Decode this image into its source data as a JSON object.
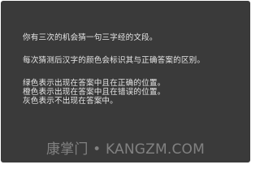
{
  "instructions": {
    "line1": "你有三次的机会猜一句三字经的文段。",
    "line2": "每次猜测后汉字的颜色会标识其与正确答案的区别。",
    "line3": "绿色表示出现在答案中且在正确的位置。",
    "line4": "橙色表示出现在答案中且在错误的位置。",
    "line5": "灰色表示不出现在答案中。"
  },
  "watermark": {
    "text": "康掌门 • KANGZM.COM"
  },
  "colors": {
    "panel_background": "#3a3a3a",
    "text": "#e6e6e6",
    "watermark": "#969696"
  }
}
